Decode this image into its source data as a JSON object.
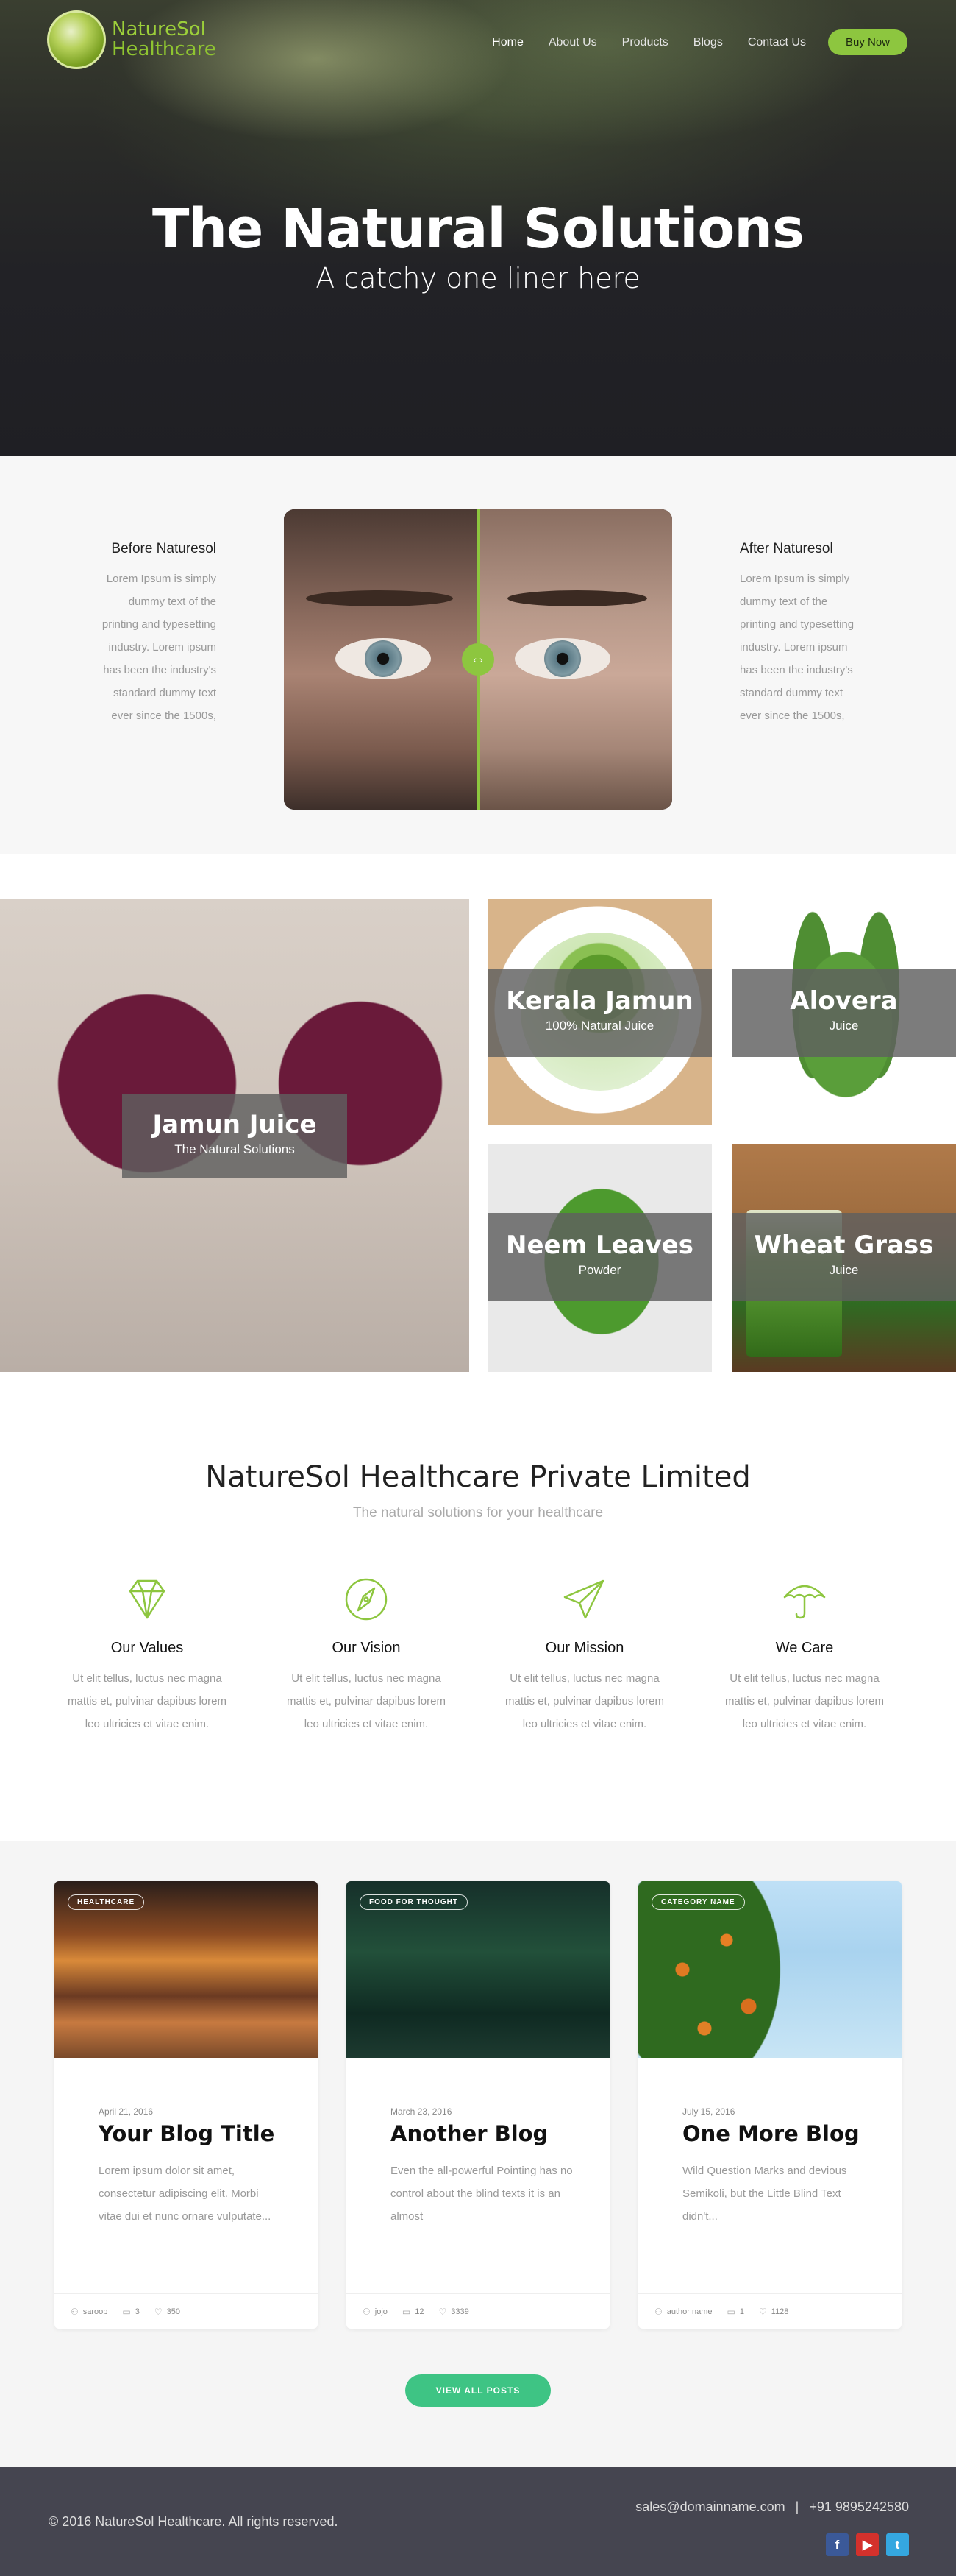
{
  "logo": {
    "line1": "NatureSol",
    "line2": "Healthcare"
  },
  "nav": {
    "items": [
      "Home",
      "About Us",
      "Products",
      "Blogs",
      "Contact Us"
    ],
    "active": "Home",
    "buy_label": "Buy Now"
  },
  "hero": {
    "title": "The Natural Solutions",
    "subtitle": "A catchy one liner here"
  },
  "compare": {
    "before_title": "Before Naturesol",
    "before_text": "Lorem Ipsum is simply dummy text of the printing and typesetting industry. Lorem ipsum has been the industry's standard dummy text ever since the 1500s,",
    "after_title": "After Naturesol",
    "after_text": "Lorem Ipsum is simply dummy text of the printing and typesetting industry. Lorem ipsum has been the industry's standard dummy text ever since the 1500s,",
    "handle_icon": "chevron-left-right-icon",
    "accent": "#8dc63f"
  },
  "products": [
    {
      "name": "Jamun Juice",
      "desc": "The Natural Solutions"
    },
    {
      "name": "Kerala Jamun",
      "desc": "100% Natural Juice"
    },
    {
      "name": "Alovera",
      "desc": "Juice"
    },
    {
      "name": "Neem Leaves",
      "desc": "Powder"
    },
    {
      "name": "Wheat Grass",
      "desc": "Juice"
    }
  ],
  "company": {
    "title": "NatureSol Healthcare Private Limited",
    "tagline": "The natural solutions for your healthcare",
    "features": [
      {
        "title": "Our Values",
        "icon": "diamond-icon",
        "text": "Ut elit tellus, luctus nec magna mattis et, pulvinar dapibus lorem leo ultricies et vitae enim."
      },
      {
        "title": "Our Vision",
        "icon": "compass-icon",
        "text": "Ut elit tellus, luctus nec magna mattis et, pulvinar dapibus lorem leo ultricies et vitae enim."
      },
      {
        "title": "Our Mission",
        "icon": "paper-plane-icon",
        "text": "Ut elit tellus, luctus nec magna mattis et, pulvinar dapibus lorem leo ultricies et vitae enim."
      },
      {
        "title": "We Care",
        "icon": "umbrella-icon",
        "text": "Ut elit tellus, luctus nec magna mattis et, pulvinar dapibus lorem leo ultricies et vitae enim."
      }
    ]
  },
  "blog": {
    "posts": [
      {
        "tag": "HEALTHCARE",
        "date": "April 21, 2016",
        "title": "Your Blog Title",
        "excerpt": "Lorem ipsum dolor sit amet, consectetur adipiscing elit. Morbi vitae dui et nunc ornare vulputate...",
        "author": "saroop",
        "comments": "3",
        "likes": "350"
      },
      {
        "tag": "FOOD FOR THOUGHT",
        "date": "March 23, 2016",
        "title": "Another Blog",
        "excerpt": "Even the all-powerful Pointing has no control about the blind texts it is an almost",
        "author": "jojo",
        "comments": "12",
        "likes": "3339"
      },
      {
        "tag": "CATEGORY NAME",
        "date": "July 15, 2016",
        "title": "One More Blog",
        "excerpt": "Wild Question Marks and devious Semikoli, but the Little Blind Text didn't...",
        "author": "author name",
        "comments": "1",
        "likes": "1128"
      }
    ],
    "view_all_label": "VIEW ALL POSTS"
  },
  "footer": {
    "copyright": "© 2016 NatureSol Healthcare. All rights reserved.",
    "email": "sales@domainname.com",
    "separator": "|",
    "phone": "+91 9895242580",
    "social": [
      "facebook-icon",
      "youtube-icon",
      "twitter-icon"
    ]
  }
}
